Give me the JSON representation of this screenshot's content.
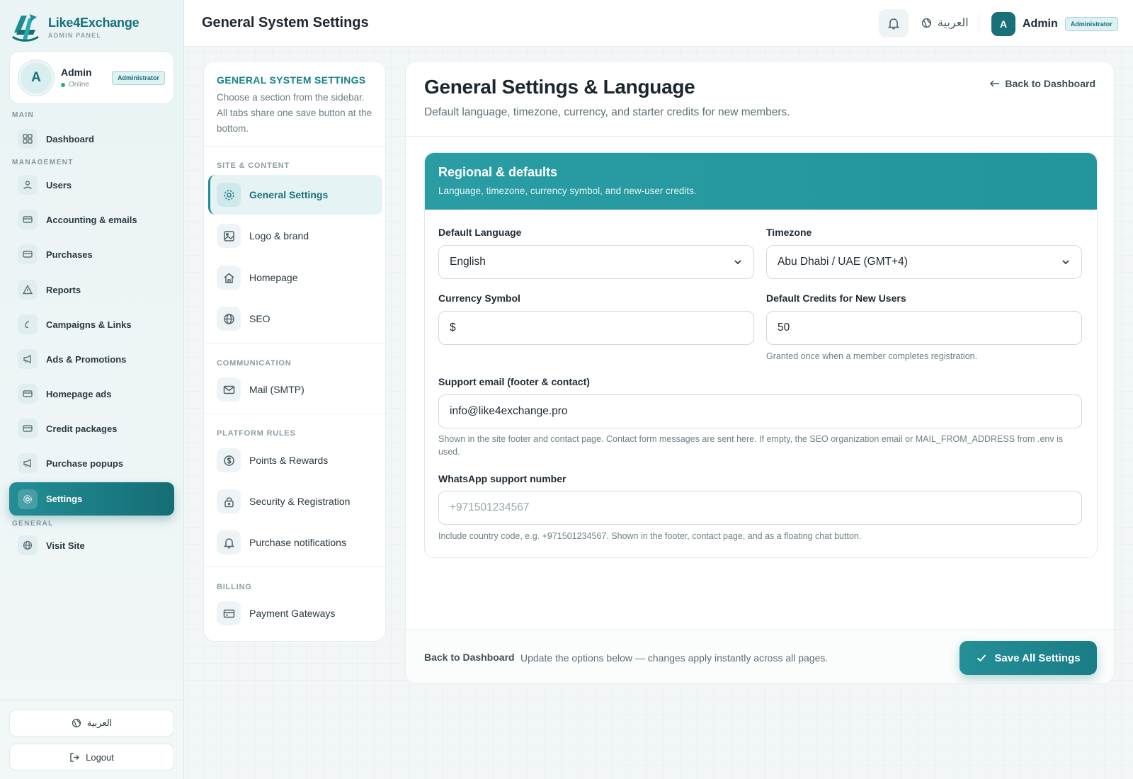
{
  "brand": {
    "name": "Like4Exchange",
    "subtitle": "ADMIN PANEL"
  },
  "profile": {
    "name": "Admin",
    "status": "Online",
    "role": "Administrator",
    "initial": "A"
  },
  "sidebar": {
    "sections": {
      "main": "MAIN",
      "management": "MANAGEMENT",
      "general": "GENERAL"
    },
    "items": [
      {
        "label": "Dashboard",
        "icon": "grid-icon"
      },
      {
        "label": "Users",
        "icon": "users-icon"
      },
      {
        "label": "Accounting & emails",
        "icon": "card-icon"
      },
      {
        "label": "Purchases",
        "icon": "card-icon"
      },
      {
        "label": "Reports",
        "icon": "alert-triangle-icon"
      },
      {
        "label": "Campaigns & Links",
        "icon": "link-icon"
      },
      {
        "label": "Ads & Promotions",
        "icon": "megaphone-icon"
      },
      {
        "label": "Homepage ads",
        "icon": "card-icon"
      },
      {
        "label": "Credit packages",
        "icon": "card-icon"
      },
      {
        "label": "Purchase popups",
        "icon": "megaphone-icon"
      },
      {
        "label": "Settings",
        "icon": "gear-icon",
        "active": true
      },
      {
        "label": "Visit Site",
        "icon": "globe-icon"
      }
    ],
    "language_button": "العربية",
    "logout_button": "Logout"
  },
  "topbar": {
    "title": "General System Settings",
    "language": "العربية",
    "user_name": "Admin",
    "user_initial": "A",
    "user_role": "Administrator"
  },
  "subnav": {
    "title": "GENERAL SYSTEM SETTINGS",
    "description": "Choose a section from the sidebar. All tabs share one save button at the bottom.",
    "sections": {
      "site_content": "SITE & CONTENT",
      "communication": "COMMUNICATION",
      "platform_rules": "PLATFORM RULES",
      "billing": "BILLING"
    },
    "items": [
      {
        "label": "General Settings",
        "icon": "gear-icon",
        "active": true
      },
      {
        "label": "Logo & brand",
        "icon": "image-icon"
      },
      {
        "label": "Homepage",
        "icon": "home-icon"
      },
      {
        "label": "SEO",
        "icon": "globe-icon"
      },
      {
        "label": "Mail (SMTP)",
        "icon": "mail-icon"
      },
      {
        "label": "Points & Rewards",
        "icon": "dollar-icon"
      },
      {
        "label": "Security & Registration",
        "icon": "lock-icon"
      },
      {
        "label": "Purchase notifications",
        "icon": "bell-icon"
      },
      {
        "label": "Payment Gateways",
        "icon": "card-icon"
      }
    ]
  },
  "main": {
    "title": "General Settings & Language",
    "subtitle": "Default language, timezone, currency, and starter credits for new members.",
    "back_link": "Back to Dashboard",
    "card": {
      "title": "Regional & defaults",
      "subtitle": "Language, timezone, currency symbol, and new-user credits."
    },
    "fields": {
      "language": {
        "label": "Default Language",
        "value": "English"
      },
      "timezone": {
        "label": "Timezone",
        "value": "Abu Dhabi / UAE (GMT+4)"
      },
      "currency": {
        "label": "Currency Symbol",
        "value": "$"
      },
      "credits": {
        "label": "Default Credits for New Users",
        "value": "50",
        "help": "Granted once when a member completes registration."
      },
      "support_email": {
        "label": "Support email (footer & contact)",
        "value": "info@like4exchange.pro",
        "help": "Shown in the site footer and contact page. Contact form messages are sent here. If empty, the SEO organization email or MAIL_FROM_ADDRESS from .env is used."
      },
      "whatsapp": {
        "label": "WhatsApp support number",
        "placeholder": "+971501234567",
        "help": "Include country code, e.g. +971501234567. Shown in the footer, contact page, and as a floating chat button."
      }
    },
    "footer": {
      "back_link": "Back to Dashboard",
      "note": "Update the options below — changes apply instantly across all pages.",
      "save_button": "Save All Settings"
    }
  },
  "colors": {
    "accent": "#1f8c95",
    "accent_dark": "#156d75",
    "online": "#22b07d"
  }
}
